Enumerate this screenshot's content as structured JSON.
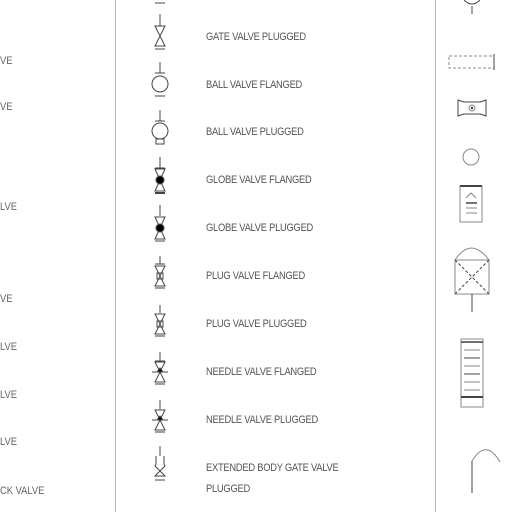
{
  "left_column_partial_labels": [
    "VE",
    "VE",
    "LVE",
    "VE",
    "LVE",
    "LVE",
    "LVE",
    "CK VALVE"
  ],
  "symbol_labels": [
    "GATE VALVE PLUGGED",
    "BALL VALVE FLANGED",
    "BALL VALVE PLUGGED",
    "GLOBE VALVE FLANGED",
    "GLOBE VALVE PLUGGED",
    "PLUG VALVE FLANGED",
    "PLUG VALVE PLUGGED",
    "NEEDLE VALVE FLANGED",
    "NEEDLE VALVE PLUGGED",
    "EXTENDED BODY GATE VALVE PLUGGED"
  ],
  "extended_label_lines": [
    "EXTENDED BODY GATE VALVE",
    "PLUGGED"
  ]
}
